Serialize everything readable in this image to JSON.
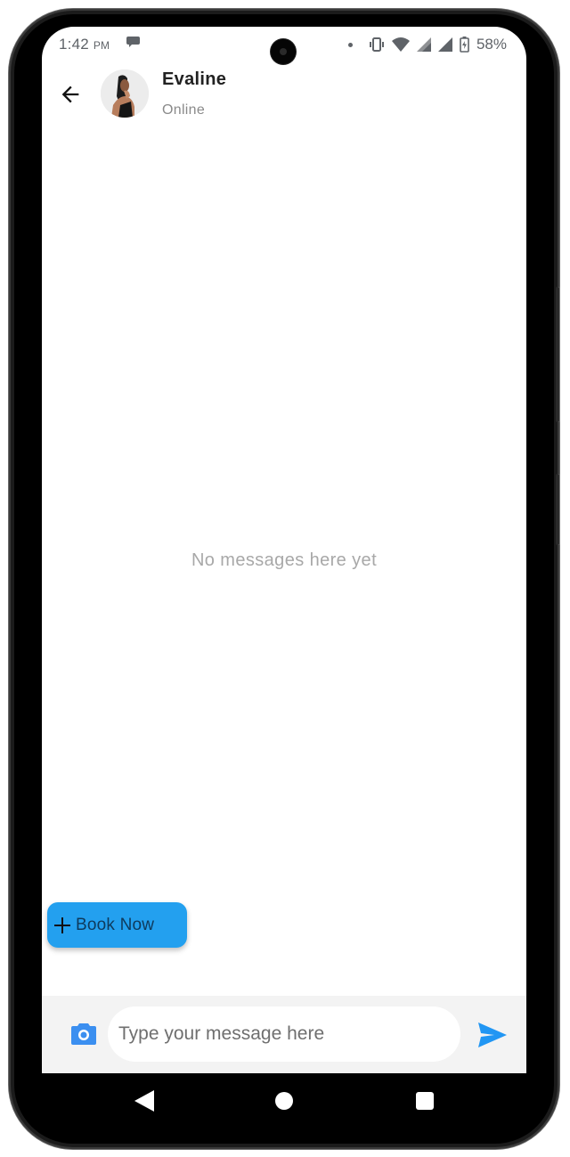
{
  "status_bar": {
    "time": "1:42",
    "ampm": "PM",
    "notification_icon": "chat-bubble-icon",
    "icons": [
      "dot-icon",
      "vibrate-icon",
      "wifi-icon",
      "signal-icon",
      "signal-icon",
      "battery-charging-icon"
    ],
    "battery_percent": "58%"
  },
  "header": {
    "back_icon": "arrow-left-icon",
    "contact_name": "Evaline",
    "contact_status": "Online"
  },
  "conversation": {
    "empty_message": "No messages here yet"
  },
  "book_button": {
    "icon": "plus-icon",
    "label": "Book Now",
    "color": "#23a0ef"
  },
  "composer": {
    "camera_icon": "camera-icon",
    "placeholder": "Type your message here",
    "value": "",
    "send_icon": "send-icon",
    "accent": "#2196f3"
  },
  "nav_bar": {
    "back": "nav-back-icon",
    "home": "nav-home-icon",
    "recents": "nav-recents-icon"
  }
}
